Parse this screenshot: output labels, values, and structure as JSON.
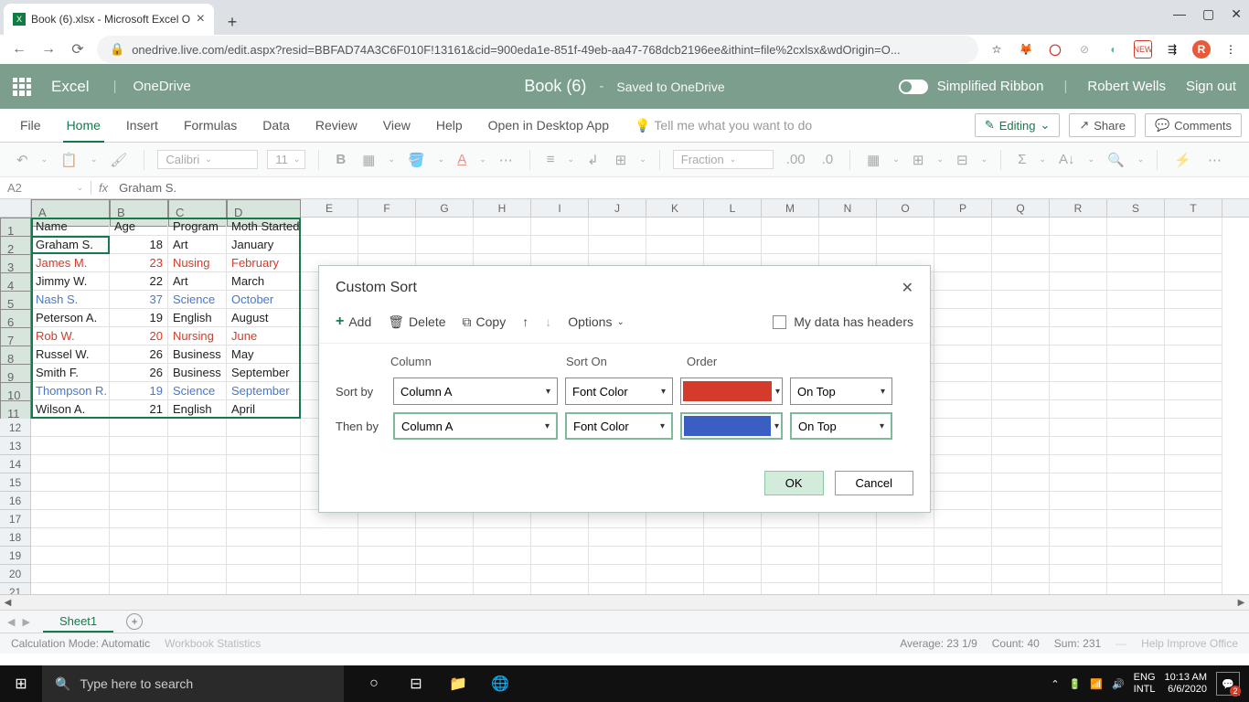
{
  "browser": {
    "tab_title": "Book (6).xlsx - Microsoft Excel O",
    "url": "onedrive.live.com/edit.aspx?resid=BBFAD74A3C6F010F!13161&cid=900eda1e-851f-49eb-aa47-768dcb2196ee&ithint=file%2cxlsx&wdOrigin=O..."
  },
  "header": {
    "app": "Excel",
    "onedrive": "OneDrive",
    "doc": "Book (6)",
    "saved": "Saved to OneDrive",
    "simplified": "Simplified Ribbon",
    "user": "Robert Wells",
    "signout": "Sign out"
  },
  "ribbon": {
    "tabs": [
      "File",
      "Home",
      "Insert",
      "Formulas",
      "Data",
      "Review",
      "View",
      "Help"
    ],
    "open_desktop": "Open in Desktop App",
    "tellme": "Tell me what you want to do",
    "editing": "Editing",
    "share": "Share",
    "comments": "Comments"
  },
  "toolbar": {
    "font": "Calibri",
    "size": "11",
    "format": "Fraction"
  },
  "formula": {
    "cell": "A2",
    "value": "Graham S."
  },
  "grid": {
    "columns": [
      "A",
      "B",
      "C",
      "D",
      "E",
      "F",
      "G",
      "H",
      "I",
      "J",
      "K",
      "L",
      "M",
      "N",
      "O",
      "P",
      "Q",
      "R",
      "S",
      "T"
    ],
    "col_a_w": 86,
    "col_b_w": 64,
    "col_c_w": 64,
    "col_d_w": 81,
    "col_rest_w": 63,
    "headers": [
      "Name",
      "Age",
      "Program",
      "Moth Started"
    ],
    "rows": [
      {
        "n": "Graham S.",
        "a": 18,
        "p": "Art",
        "m": "January",
        "c": "black"
      },
      {
        "n": "James M.",
        "a": 23,
        "p": "Nusing",
        "m": "February",
        "c": "red"
      },
      {
        "n": "Jimmy W.",
        "a": 22,
        "p": "Art",
        "m": "March",
        "c": "black"
      },
      {
        "n": "Nash S.",
        "a": 37,
        "p": "Science",
        "m": "October",
        "c": "blue"
      },
      {
        "n": "Peterson A.",
        "a": 19,
        "p": "English",
        "m": "August",
        "c": "black"
      },
      {
        "n": "Rob W.",
        "a": 20,
        "p": "Nursing",
        "m": "June",
        "c": "red"
      },
      {
        "n": "Russel W.",
        "a": 26,
        "p": "Business",
        "m": "May",
        "c": "black"
      },
      {
        "n": "Smith F.",
        "a": 26,
        "p": "Business",
        "m": "September",
        "c": "black"
      },
      {
        "n": "Thompson R.",
        "a": 19,
        "p": "Science",
        "m": "September",
        "c": "blue"
      },
      {
        "n": "Wilson A.",
        "a": 21,
        "p": "English",
        "m": "April",
        "c": "black"
      }
    ]
  },
  "dialog": {
    "title": "Custom Sort",
    "add": "Add",
    "delete": "Delete",
    "copy": "Copy",
    "options": "Options",
    "headers_checkbox": "My data has headers",
    "col_hdr": "Column",
    "sorton_hdr": "Sort On",
    "order_hdr": "Order",
    "sortby": "Sort by",
    "thenby": "Then by",
    "columnA": "Column A",
    "fontcolor": "Font Color",
    "ontop": "On Top",
    "color1": "#d43b2a",
    "color2": "#3a5ec1",
    "ok": "OK",
    "cancel": "Cancel"
  },
  "sheets": {
    "sheet1": "Sheet1"
  },
  "status": {
    "calc": "Calculation Mode: Automatic",
    "wb_stats": "Workbook Statistics",
    "average": "Average: 23 1/9",
    "count": "Count: 40",
    "sum": "Sum: 231",
    "help": "Help Improve Office"
  },
  "taskbar": {
    "search": "Type here to search",
    "lang1": "ENG",
    "lang2": "INTL",
    "time": "10:13 AM",
    "date": "6/6/2020",
    "notif_count": "2"
  }
}
